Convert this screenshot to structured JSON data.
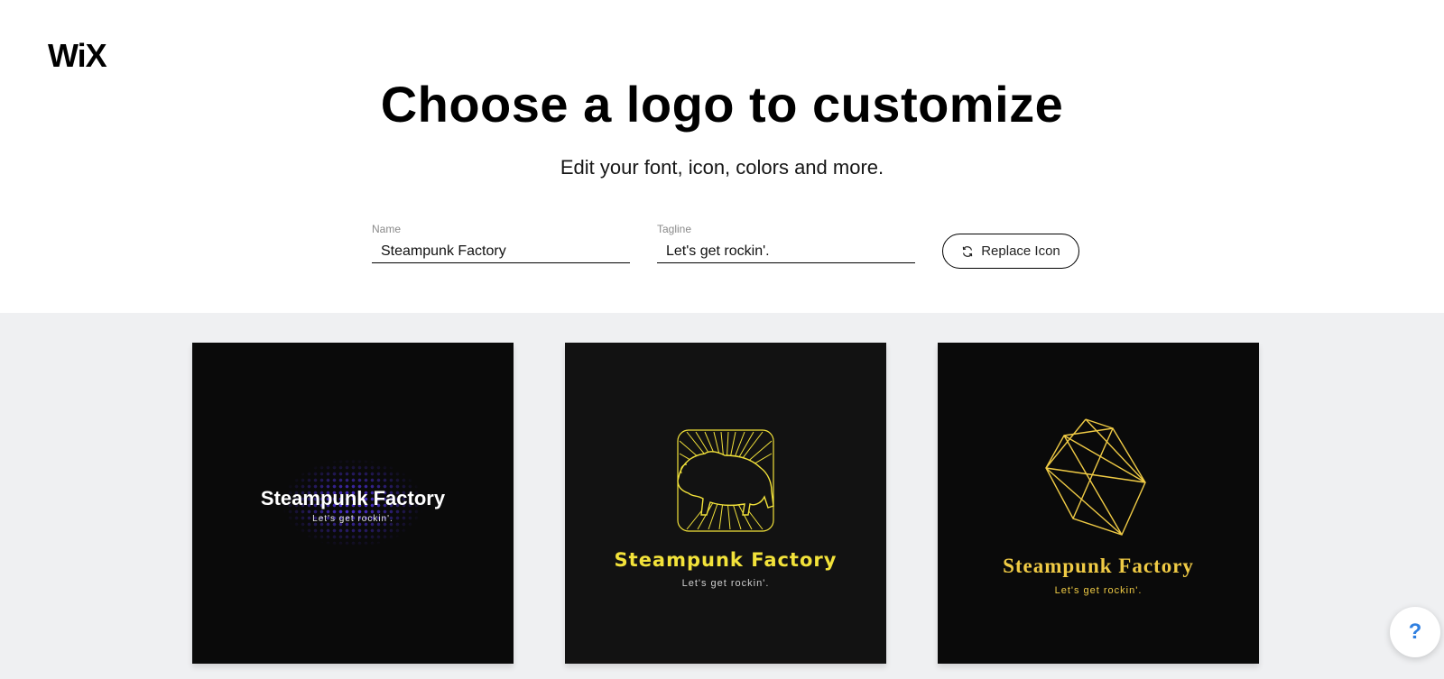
{
  "brand": {
    "logo_text": "WiX"
  },
  "header": {
    "title": "Choose a logo to customize",
    "subtitle": "Edit your font, icon, colors and more."
  },
  "form": {
    "name_label": "Name",
    "name_value": "Steampunk Factory",
    "tagline_label": "Tagline",
    "tagline_value": "Let's get rockin'.",
    "replace_icon_label": "Replace Icon"
  },
  "logos": [
    {
      "name": "Steampunk Factory",
      "tagline": "Let's get rockin'.",
      "icon": "halftone-glow-icon",
      "name_color": "#ffffff",
      "accent_color": "#4a2fd0",
      "background": "#0a0a0a"
    },
    {
      "name": "Steampunk Factory",
      "tagline": "Let's get rockin'.",
      "icon": "bison-sunburst-icon",
      "name_color": "#f2e23a",
      "background": "#121212"
    },
    {
      "name": "Steampunk Factory",
      "tagline": "Let's get rockin'.",
      "icon": "geometric-polygon-icon",
      "name_color": "#f0cb45",
      "background": "#0a0a0a"
    }
  ],
  "help": {
    "label": "?"
  },
  "colors": {
    "gallery_background": "#eff0f2",
    "help_accent": "#2f7fe0"
  }
}
